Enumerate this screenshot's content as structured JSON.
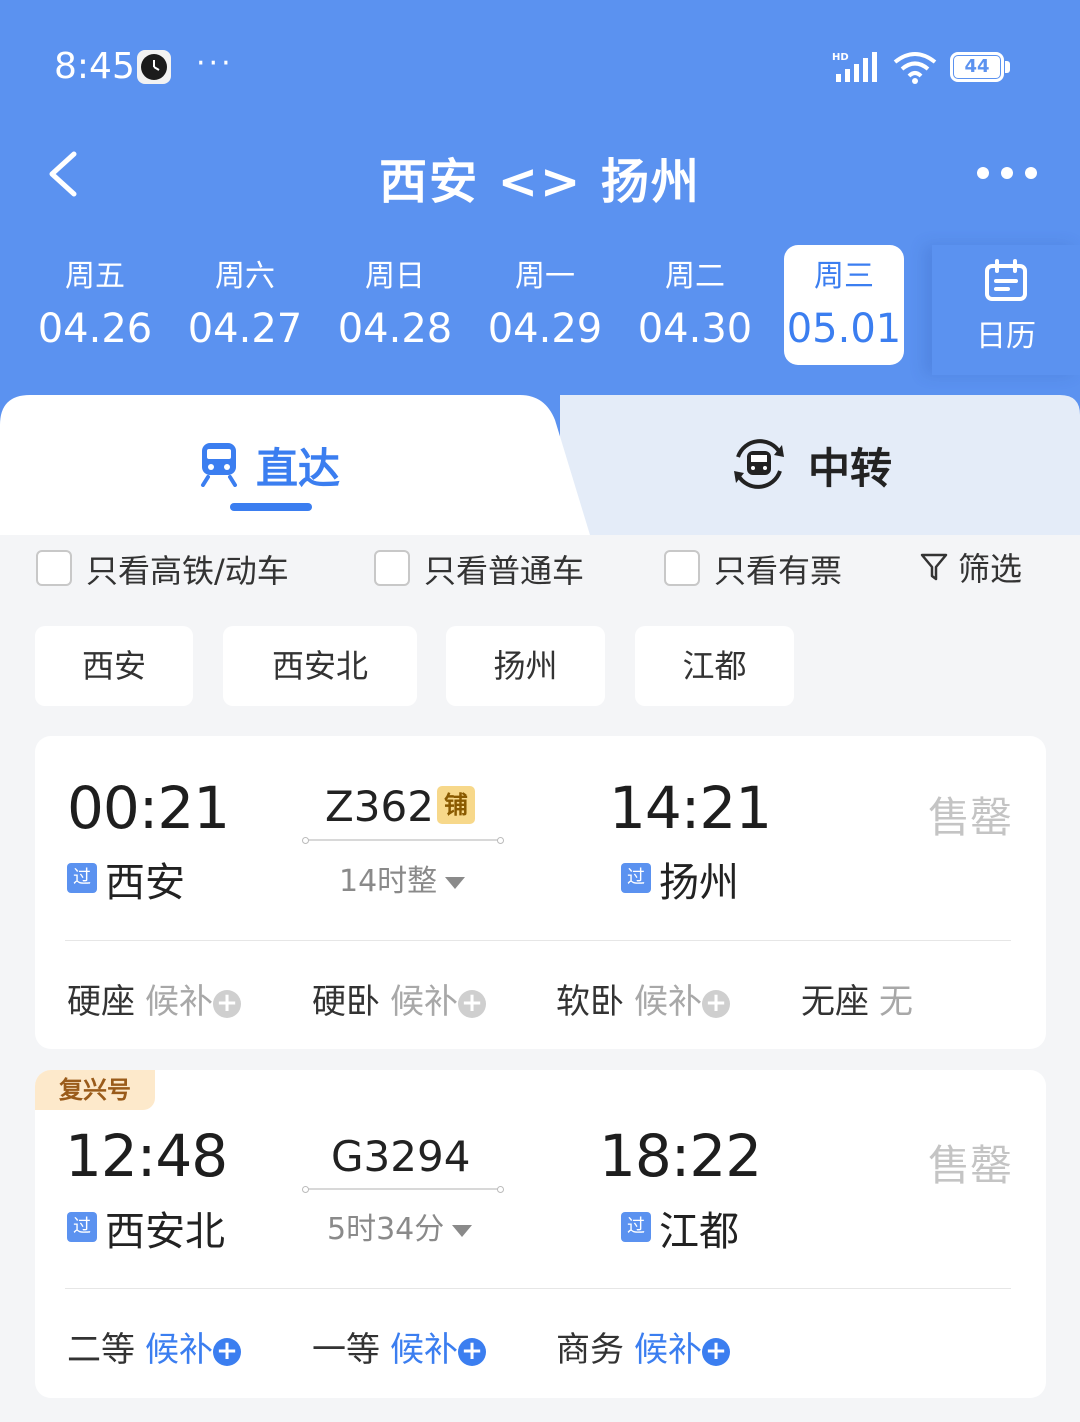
{
  "status_bar": {
    "time": "8:45",
    "dots": "···",
    "battery": "44",
    "icons": [
      "clock-app-icon",
      "hd-signal-icon",
      "wifi-icon",
      "battery-icon"
    ]
  },
  "nav": {
    "title": "西安 <> 扬州",
    "back_icon": "chevron-left-icon",
    "more_icon": "more-horizontal-icon"
  },
  "dates": [
    {
      "dow": "周五",
      "md": "04.26"
    },
    {
      "dow": "周六",
      "md": "04.27"
    },
    {
      "dow": "周日",
      "md": "04.28"
    },
    {
      "dow": "周一",
      "md": "04.29"
    },
    {
      "dow": "周二",
      "md": "04.30"
    },
    {
      "dow": "周三",
      "md": "05.01",
      "selected": true
    }
  ],
  "calendar": {
    "label": "日历",
    "icon": "calendar-icon"
  },
  "tabs": {
    "direct": "直达",
    "transfer": "中转",
    "active": "direct"
  },
  "filters": {
    "high_speed": "只看高铁/动车",
    "normal": "只看普通车",
    "available": "只看有票",
    "filter_btn": "筛选"
  },
  "station_chips": [
    "西安",
    "西安北",
    "扬州",
    "江都"
  ],
  "trains": [
    {
      "tag": "",
      "dep_time": "00:21",
      "dep_station": "西安",
      "dep_tag": "过",
      "train_no": "Z362",
      "berth_tag": "铺",
      "duration": "14时整",
      "arr_time": "14:21",
      "arr_station": "扬州",
      "arr_tag": "过",
      "status": "售罄",
      "seats": [
        {
          "name": "硬座",
          "state": "候补"
        },
        {
          "name": "硬卧",
          "state": "候补"
        },
        {
          "name": "软卧",
          "state": "候补"
        },
        {
          "name": "无座",
          "state": "无"
        }
      ]
    },
    {
      "tag": "复兴号",
      "dep_time": "12:48",
      "dep_station": "西安北",
      "dep_tag": "过",
      "train_no": "G3294",
      "duration": "5时34分",
      "arr_time": "18:22",
      "arr_station": "江都",
      "arr_tag": "过",
      "status": "售罄",
      "seats": [
        {
          "name": "二等",
          "state": "候补"
        },
        {
          "name": "一等",
          "state": "候补"
        },
        {
          "name": "商务",
          "state": "候补"
        }
      ]
    }
  ],
  "colors": {
    "header_blue": "#5b92f0",
    "accent_blue": "#3b7ef0",
    "soldout_gray": "#c4c4c4",
    "fuxing_bg": "#fde9cb"
  }
}
